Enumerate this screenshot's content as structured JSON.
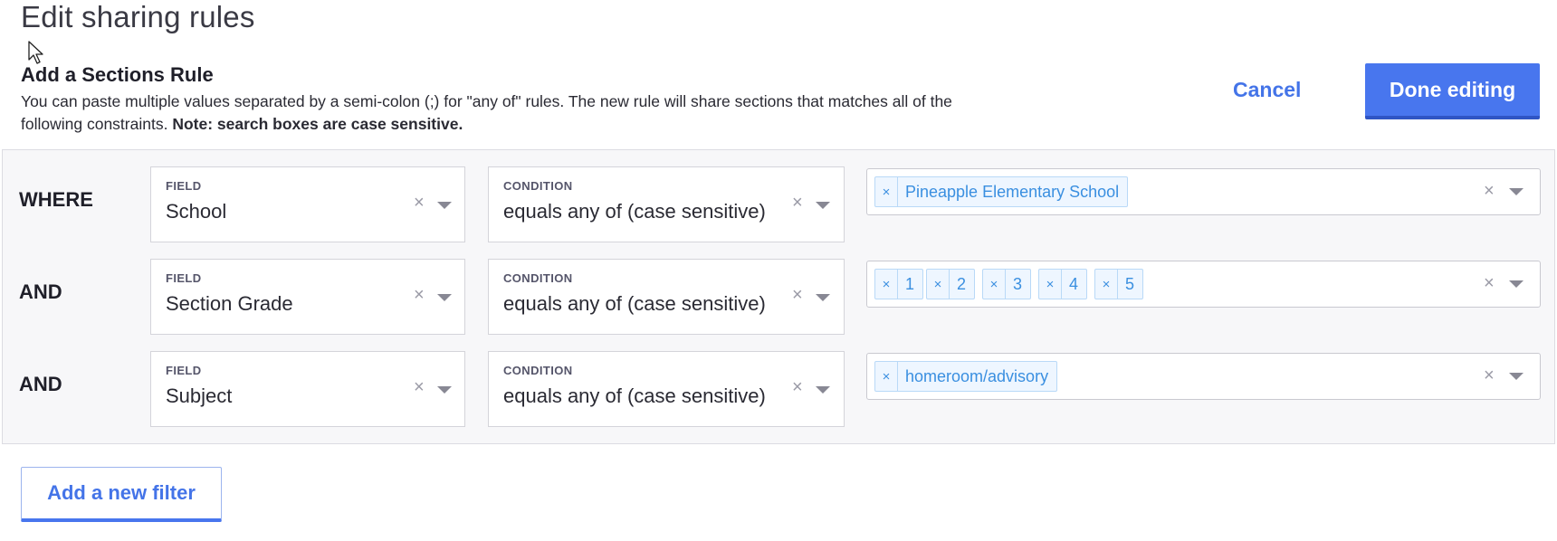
{
  "page": {
    "title": "Edit sharing rules"
  },
  "rule": {
    "heading": "Add a Sections Rule",
    "description": "You can paste multiple values separated by a semi-colon (;) for \"any of\" rules. The new rule will share sections that matches all of the following constraints. ",
    "note": "Note: search boxes are case sensitive."
  },
  "actions": {
    "cancel_label": "Cancel",
    "done_label": "Done editing",
    "add_filter_label": "Add a new filter"
  },
  "icons": {
    "cursor": "arrow-cursor-icon",
    "clear": "close-icon",
    "dropdown": "caret-down-icon"
  },
  "colors": {
    "accent": "#4876ee",
    "tag_bg": "#eef6ff",
    "tag_text": "#3a8fe0"
  },
  "clear_glyph": "×",
  "filters": [
    {
      "connector": "WHERE",
      "field_caption": "FIELD",
      "field_value": "School",
      "condition_caption": "CONDITION",
      "condition_value": "equals any of (case sensitive)",
      "values": [
        "Pineapple Elementary School"
      ]
    },
    {
      "connector": "AND",
      "field_caption": "FIELD",
      "field_value": "Section Grade",
      "condition_caption": "CONDITION",
      "condition_value": "equals any of (case sensitive)",
      "values": [
        "1",
        "2",
        "3",
        "4",
        "5"
      ]
    },
    {
      "connector": "AND",
      "field_caption": "FIELD",
      "field_value": "Subject",
      "condition_caption": "CONDITION",
      "condition_value": "equals any of (case sensitive)",
      "values": [
        "homeroom/advisory"
      ]
    }
  ]
}
